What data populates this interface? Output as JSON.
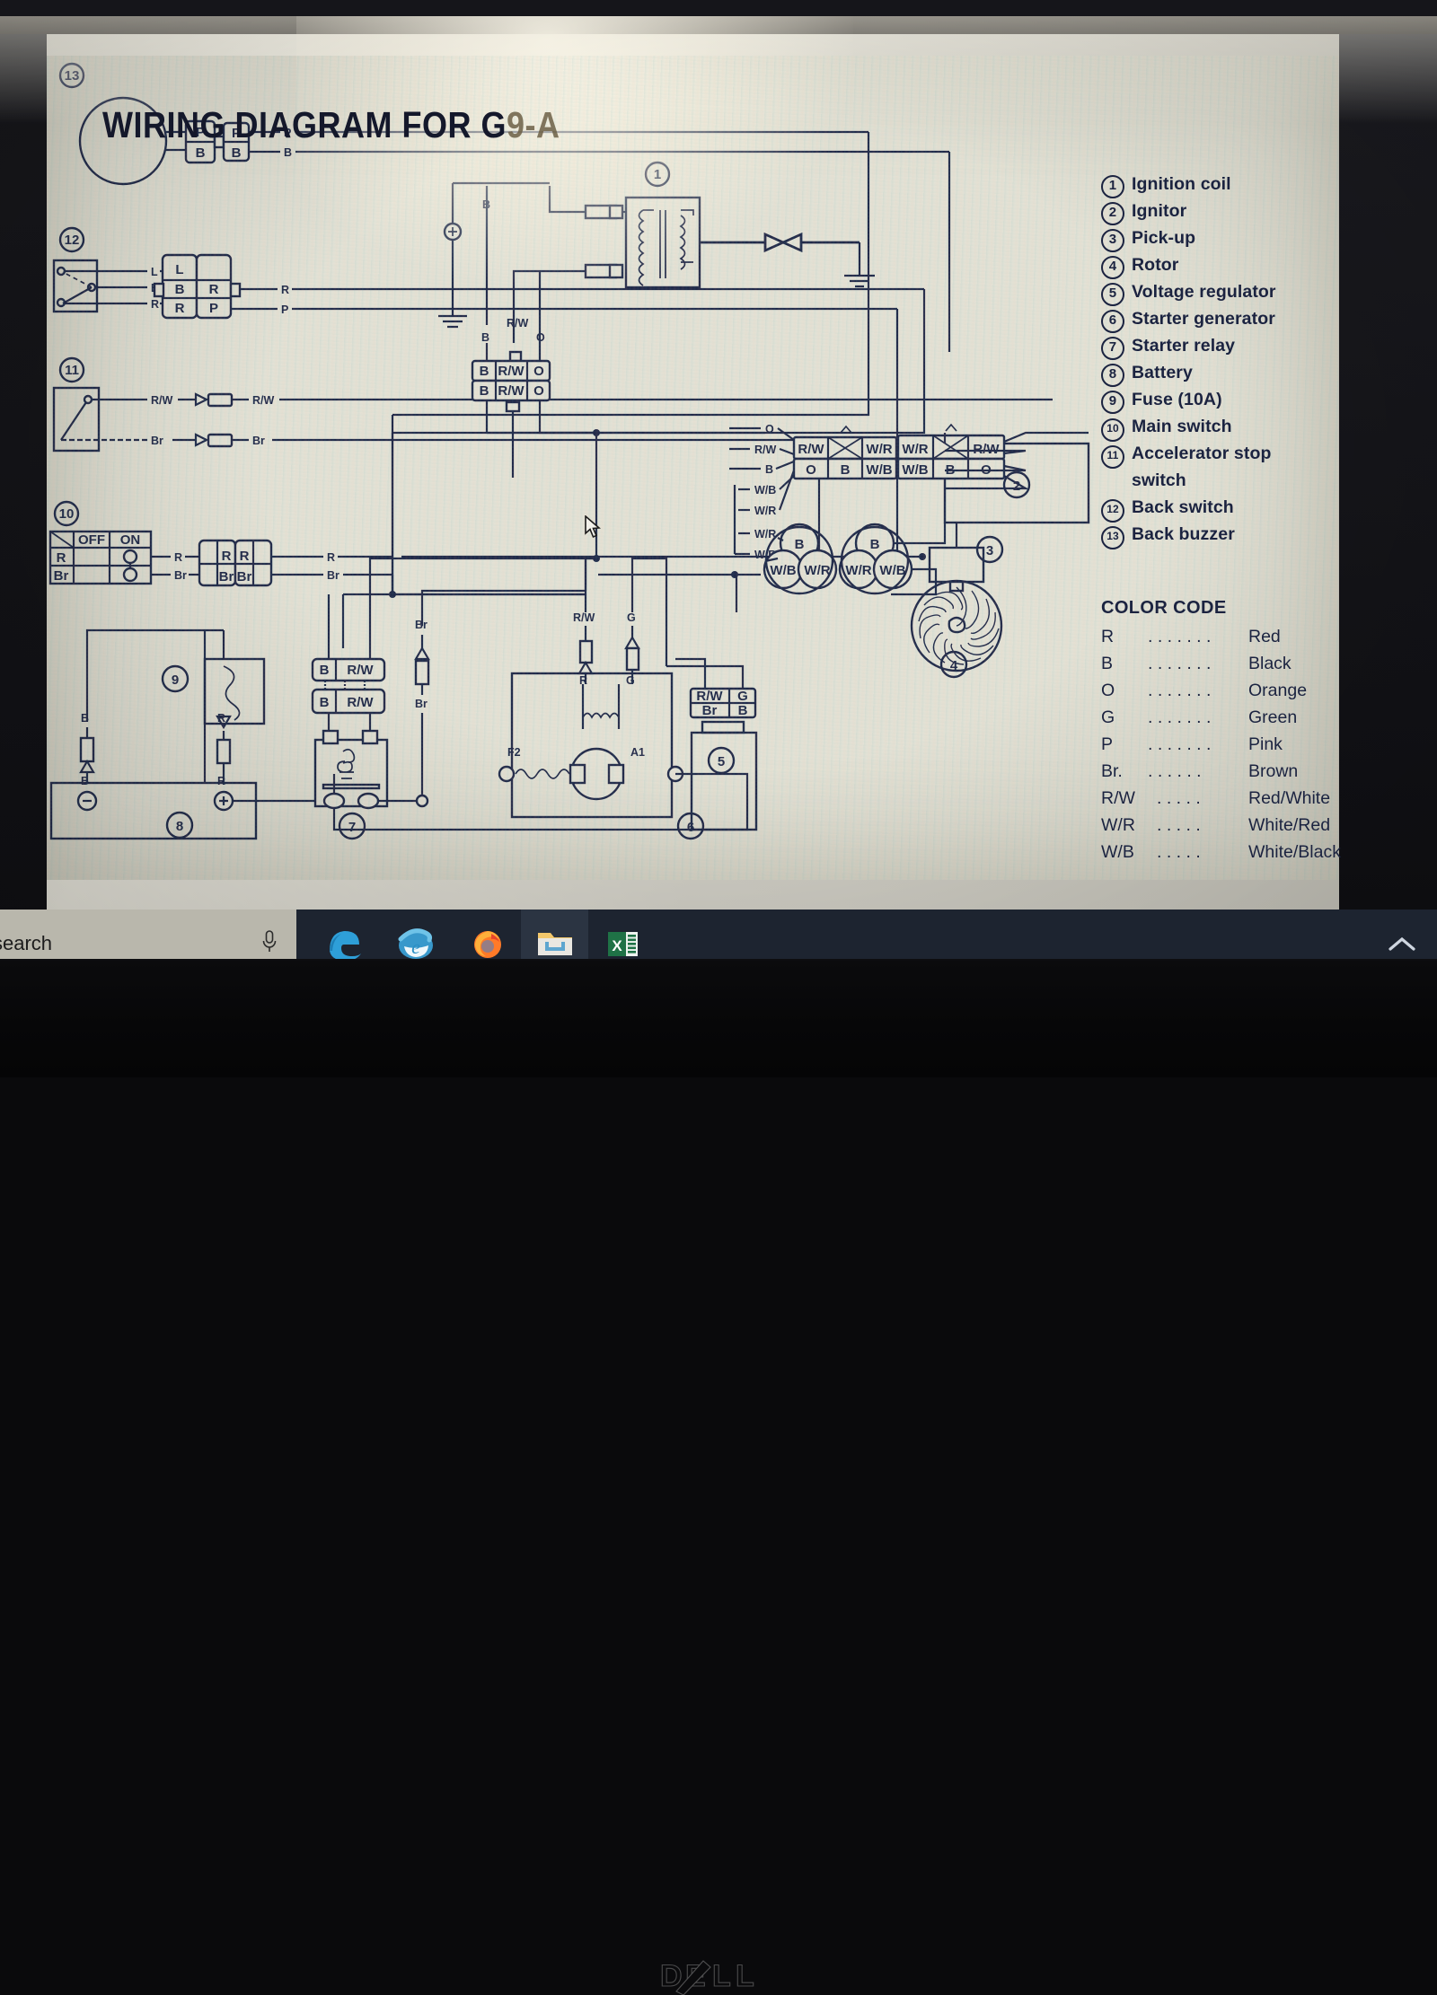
{
  "document": {
    "title_main": "WIRING DIAGRAM FOR G",
    "title_tail": "9-A",
    "title_full": "WIRING DIAGRAM FOR G9-A"
  },
  "legend": {
    "items": [
      {
        "num": "1",
        "label": "Ignition coil"
      },
      {
        "num": "2",
        "label": "Ignitor"
      },
      {
        "num": "3",
        "label": "Pick-up"
      },
      {
        "num": "4",
        "label": "Rotor"
      },
      {
        "num": "5",
        "label": "Voltage regulator"
      },
      {
        "num": "6",
        "label": "Starter generator"
      },
      {
        "num": "7",
        "label": "Starter relay"
      },
      {
        "num": "8",
        "label": "Battery"
      },
      {
        "num": "9",
        "label": "Fuse (10A)"
      },
      {
        "num": "10",
        "label": "Main switch"
      },
      {
        "num": "11",
        "label": "Accelerator stop"
      },
      {
        "num": "12",
        "label": "Back switch"
      },
      {
        "num": "13",
        "label": "Back buzzer"
      }
    ],
    "continuation_line": "switch"
  },
  "color_code": {
    "heading": "COLOR CODE",
    "rows": [
      {
        "code": "R",
        "dots": ". . . . . . .",
        "name": "Red"
      },
      {
        "code": "B",
        "dots": ". . . . . . .",
        "name": "Black"
      },
      {
        "code": "O",
        "dots": ". . . . . . .",
        "name": "Orange"
      },
      {
        "code": "G",
        "dots": ". . . . . . .",
        "name": "Green"
      },
      {
        "code": "P",
        "dots": ". . . . . . .",
        "name": "Pink"
      },
      {
        "code": "Br.",
        "dots": ". . . . . .",
        "name": "Brown"
      },
      {
        "code": "R/W",
        "dots": ". . . . .",
        "name": "Red/White"
      },
      {
        "code": "W/R",
        "dots": ". . . . .",
        "name": "White/Red"
      },
      {
        "code": "W/B",
        "dots": ". . . . .",
        "name": "White/Black"
      }
    ]
  },
  "diagram": {
    "callouts": [
      "1",
      "2",
      "3",
      "4",
      "5",
      "6",
      "7",
      "8",
      "9",
      "10",
      "11",
      "12",
      "13"
    ],
    "back_buzzer": {
      "connector_left": [
        "P",
        "B"
      ],
      "connector_right": [
        "P",
        "B"
      ],
      "wires": [
        "P",
        "B"
      ]
    },
    "back_switch": {
      "terminals": [
        "L",
        "B",
        "R"
      ],
      "connector_left": [
        "L",
        "B",
        "R"
      ],
      "connector_right": [
        "R",
        "P"
      ],
      "wires": [
        "R",
        "P"
      ]
    },
    "accel_stop_switch": {
      "wires_in": [
        "R/W",
        "Br"
      ],
      "wires_out": [
        "R/W",
        "Br"
      ]
    },
    "main_switch": {
      "table_headers": [
        "",
        "OFF",
        "ON"
      ],
      "table_rows": [
        {
          "label": "R",
          "off": "",
          "on": "○"
        },
        {
          "label": "Br",
          "off": "",
          "on": "○"
        }
      ],
      "connector_left": [
        "R",
        "Br"
      ],
      "connector_right": [
        "R",
        "Br"
      ],
      "wires": [
        "R",
        "Br"
      ]
    },
    "ignition_coil": {
      "ground_label": "B",
      "wires": [
        "B",
        "O"
      ],
      "coil_wire": "R/W",
      "connector_top": [
        "B",
        "R/W",
        "O"
      ],
      "connector_bottom": [
        "B",
        "R/W",
        "O"
      ]
    },
    "ignitor": {
      "wire_labels_left": [
        "O",
        "R/W",
        "B",
        "W/B",
        "W/R"
      ],
      "connector_a_top": [
        "R/W",
        "×",
        "W/R"
      ],
      "connector_a_bottom": [
        "O",
        "B",
        "W/B"
      ],
      "connector_b_top": [
        "W/R",
        "×",
        "R/W"
      ],
      "connector_b_bottom": [
        "W/B",
        "B",
        "O"
      ]
    },
    "pickup": {
      "wire_labels": [
        "W/R",
        "W/B",
        "B"
      ],
      "left_cluster": {
        "top": "B",
        "bottom": [
          "W/B",
          "W/R"
        ]
      },
      "right_cluster": {
        "top": "B",
        "bottom": [
          "W/R",
          "W/B"
        ]
      }
    },
    "fuse": {
      "wires": [
        "B",
        "R"
      ],
      "wires_lower": [
        "B",
        "R"
      ]
    },
    "starter_relay": {
      "connector_top": [
        "B",
        "R/W"
      ],
      "connector_bottom": [
        "B",
        "R/W"
      ],
      "wire_side": "Br",
      "wire_side_lower": "Br"
    },
    "starter_generator": {
      "terminal_left": "F2",
      "terminal_right": "A1",
      "field_wires": [
        "R/W",
        "G"
      ],
      "field_wires_lower": [
        "R",
        "G"
      ]
    },
    "voltage_regulator": {
      "connector_top": [
        "R/W",
        "G"
      ],
      "connector_bottom": [
        "Br",
        "B"
      ]
    },
    "battery": {
      "neg": "−",
      "pos": "+"
    }
  },
  "taskbar": {
    "search_text": "search",
    "icons": [
      {
        "name": "microphone-icon",
        "label": "Microphone"
      },
      {
        "name": "edge-icon",
        "label": "Microsoft Edge"
      },
      {
        "name": "internet-explorer-icon",
        "label": "Internet Explorer"
      },
      {
        "name": "firefox-icon",
        "label": "Mozilla Firefox"
      },
      {
        "name": "file-explorer-icon",
        "label": "File Explorer"
      },
      {
        "name": "excel-icon",
        "label": "Microsoft Excel"
      }
    ],
    "tray_chevron": "∧"
  },
  "hardware": {
    "brand": "DELL"
  },
  "colors": {
    "ink": "#1b2340",
    "paper": "#e4e2d6",
    "taskbar": "#1d2430",
    "search_bg": "#b9b7ac",
    "accent_blue": "#4aa3e0",
    "title_fade": "#6d6046"
  }
}
